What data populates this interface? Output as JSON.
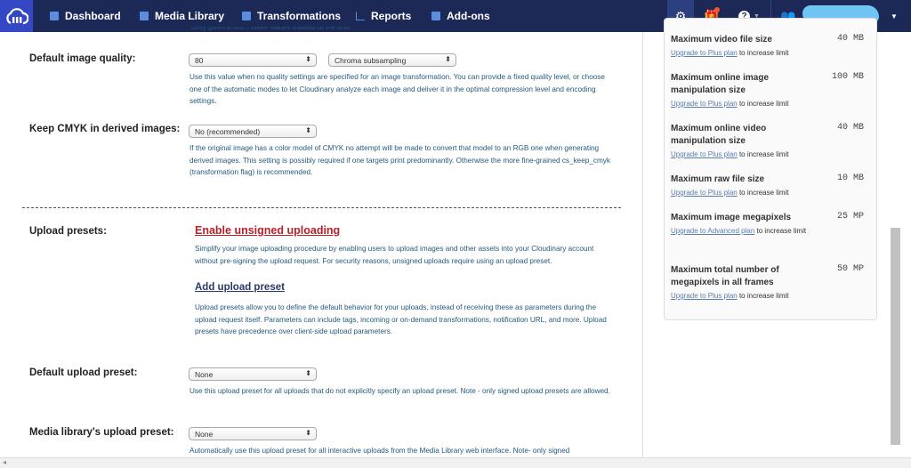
{
  "nav": {
    "items": [
      {
        "label": "Dashboard",
        "icon": "dashboard-icon"
      },
      {
        "label": "Media Library",
        "icon": "media-library-icon"
      },
      {
        "label": "Transformations",
        "icon": "transformations-icon"
      },
      {
        "label": "Reports",
        "icon": "reports-icon"
      },
      {
        "label": "Add-ons",
        "icon": "addons-icon"
      }
    ],
    "icons": [
      "settings-gear-icon",
      "whats-new-icon",
      "help-icon",
      "users-icon"
    ],
    "colors": {
      "bar": "#1c2957",
      "logo": "#3448c5",
      "notification": "#f05a28"
    }
  },
  "settings": {
    "cut_text": "Only given limits... lower values instead of the limit",
    "quality": {
      "label": "Default image quality:",
      "value": "80",
      "chroma": "Chroma subsampling",
      "help": "Use this value when no quality settings are specified for an image transformation. You can provide a fixed quality level, or choose one of the automatic modes to let Cloudinary analyze each image and deliver it in the optimal compression level and encoding settings."
    },
    "cmyk": {
      "label": "Keep CMYK in derived images:",
      "value": "No (recommended)",
      "help": "If the original image has a color model of CMYK no attempt will be made to convert that model to an RGB one when generating derived images. This setting is possibly required if one targets print predominantly. Otherwise the more fine-grained cs_keep_cmyk (transformation flag) is recommended."
    },
    "presets": {
      "label": "Upload presets:",
      "enable_link": "Enable unsigned uploading",
      "enable_help": "Simplify your image uploading procedure by enabling users to upload images and other assets into your Cloudinary account without pre-signing the upload request. For security reasons, unsigned uploads require using an upload preset.",
      "add_link": "Add upload preset",
      "add_help": "Upload presets allow you to define the default behavior for your uploads, instead of receiving these as parameters during the upload request itself. Parameters can include tags, incoming or on-demand transformations, notification URL, and more. Upload presets have precedence over client-side upload parameters."
    },
    "default_preset": {
      "label": "Default upload preset:",
      "value": "None",
      "help": "Use this upload preset for all uploads that do not explicitly specify an upload preset. Note - only signed upload presets are allowed."
    },
    "ml_preset": {
      "label": "Media library's upload preset:",
      "value": "None",
      "help": "Automatically use this upload preset for all interactive uploads from the Media Library web interface. Note- only signed"
    }
  },
  "limits": [
    {
      "title": "Maximum video file size",
      "value": "40 MB",
      "link": "Upgrade to Plus plan",
      "suffix": " to increase limit"
    },
    {
      "title": "Maximum online image manipulation size",
      "value": "100 MB",
      "link": "Upgrade to Plus plan",
      "suffix": " to increase limit"
    },
    {
      "title": "Maximum online video manipulation size",
      "value": "40 MB",
      "link": "Upgrade to Plus plan",
      "suffix": " to increase limit"
    },
    {
      "title": "Maximum raw file size",
      "value": "10 MB",
      "link": "Upgrade to Plus plan",
      "suffix": " to increase limit"
    },
    {
      "title": "Maximum image megapixels",
      "value": "25 MP",
      "link": "Upgrade to Advanced plan",
      "suffix": " to increase limit"
    },
    {
      "title": "Maximum total number of megapixels in all frames",
      "value": "50 MP",
      "link": "Upgrade to Plus plan",
      "suffix": " to increase limit"
    }
  ]
}
